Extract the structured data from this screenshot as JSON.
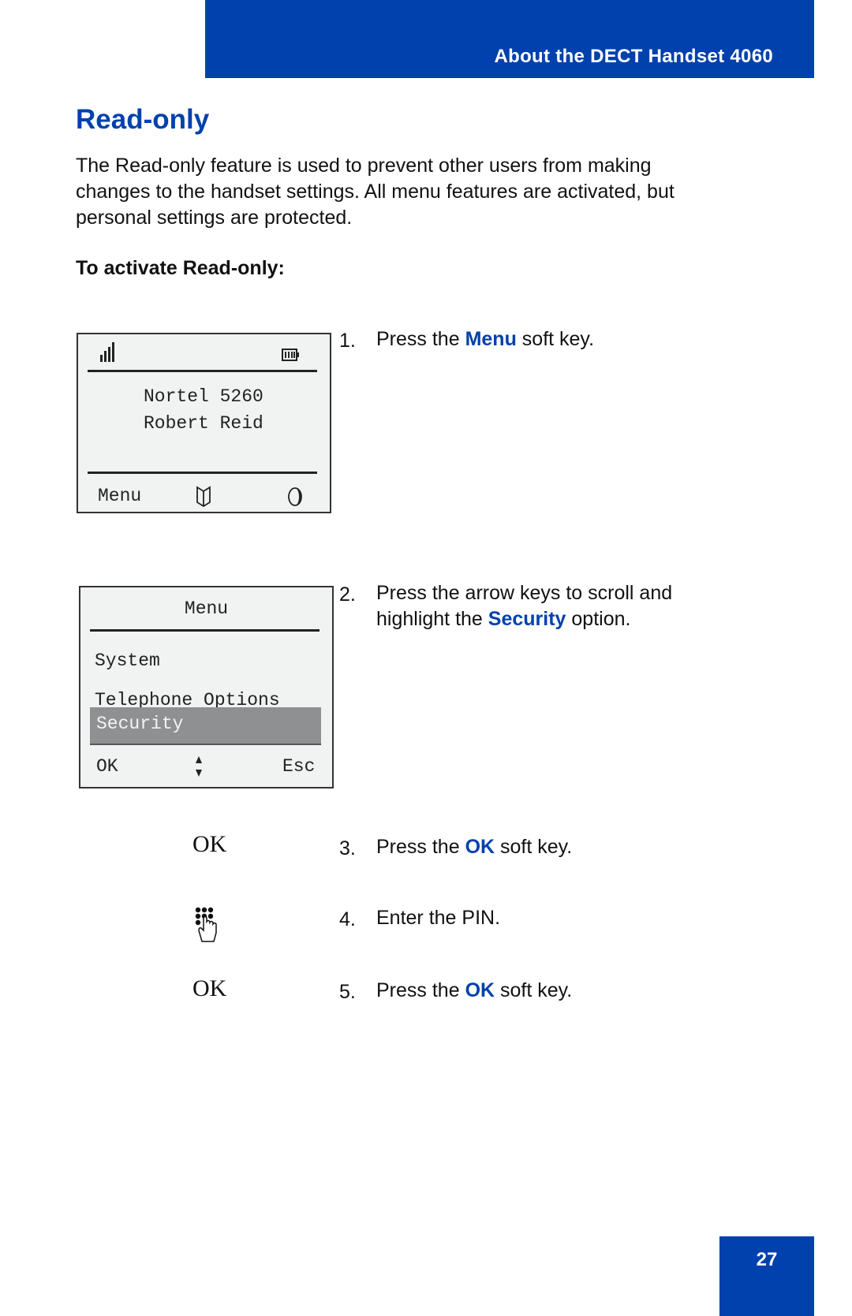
{
  "header": {
    "title": "About the DECT Handset 4060"
  },
  "section": {
    "title": "Read-only",
    "intro": "The Read-only feature is used to prevent other users from making changes to the handset settings. All menu features are activated, but personal settings are protected.",
    "intro_lines": [
      "The Read-only feature is used to prevent other users from making",
      "changes to the handset settings. All menu features are activated, but",
      "personal settings are protected."
    ],
    "procedure_heading": "To activate Read-only:"
  },
  "screen1": {
    "icons": {
      "signal": "signal-strength-icon",
      "battery": "battery-icon",
      "phonebook": "phonebook-icon",
      "contrast": "half-moon-icon"
    },
    "line1": "Nortel 5260",
    "line2": "Robert Reid",
    "softkey_left": "Menu"
  },
  "screen2": {
    "title": "Menu",
    "items": [
      "System",
      "Telephone Options",
      "Security"
    ],
    "selected_index": 2,
    "softkey_left": "OK",
    "softkey_right": "Esc",
    "icons": {
      "scroll": "up-down-arrow-icon"
    }
  },
  "steps": [
    {
      "num": "1.",
      "pre": "Press the ",
      "key": "Menu",
      "post": " soft key."
    },
    {
      "num": "2.",
      "pre": "Press the arrow keys to scroll and",
      "pre2": "highlight the ",
      "key": "Security",
      "post": " option."
    },
    {
      "num": "3.",
      "pre": "Press the ",
      "key": "OK",
      "post": " soft key.",
      "side": "OK"
    },
    {
      "num": "4.",
      "pre": "Enter the PIN.",
      "side_icon": "keypad-hand-icon"
    },
    {
      "num": "5.",
      "pre": "Press the ",
      "key": "OK",
      "post": " soft key.",
      "side": "OK"
    }
  ],
  "footer": {
    "page_number": "27"
  },
  "colors": {
    "brand_blue": "#0041ad",
    "lcd_bg": "#f1f2f2",
    "highlight": "#8e9092"
  }
}
